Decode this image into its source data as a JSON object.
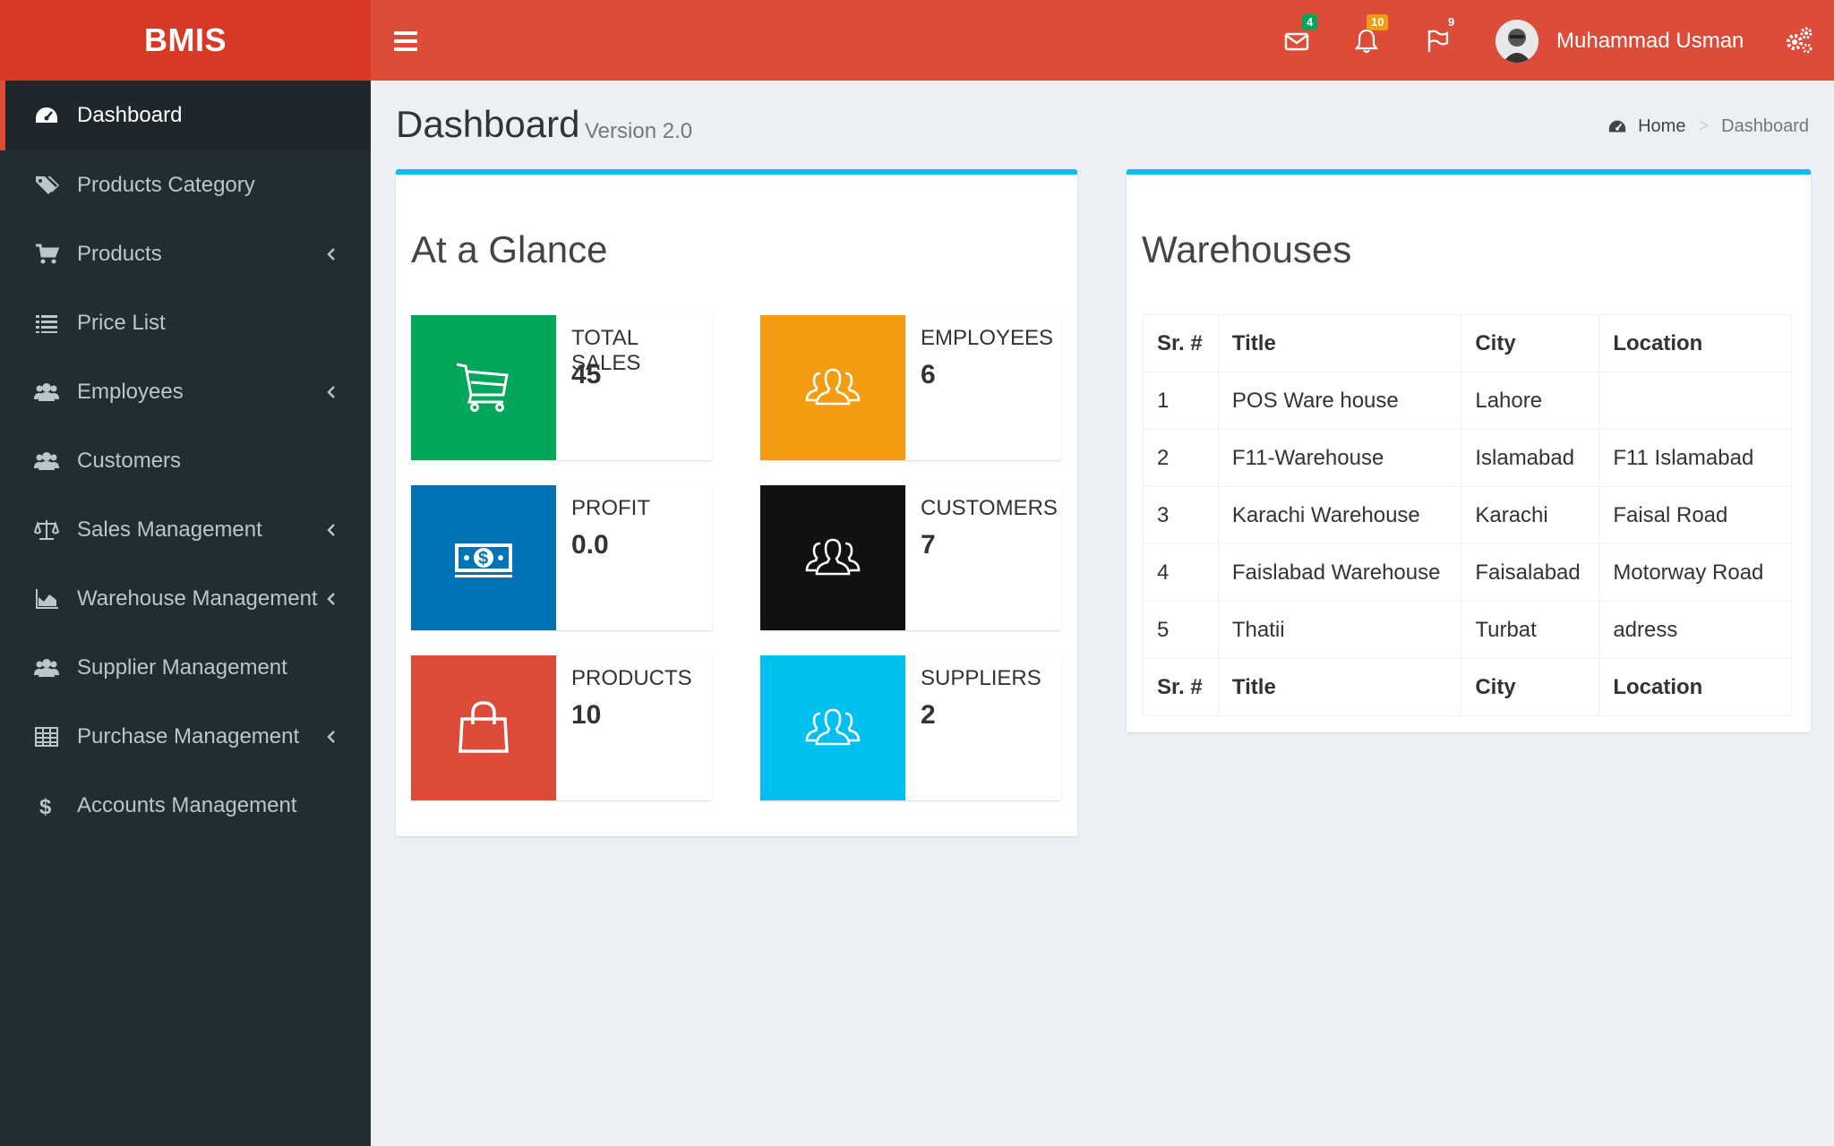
{
  "app": {
    "logo": "BMIS"
  },
  "colors": {
    "header": "#dd4b39",
    "logo_bg": "#d73925",
    "sidebar": "#222d32",
    "accent_border": "#00c0ef"
  },
  "sidebar": {
    "items": [
      {
        "label": "Dashboard",
        "icon": "dashboard-icon",
        "active": true,
        "submenu": false
      },
      {
        "label": "Products Category",
        "icon": "tags-icon",
        "active": false,
        "submenu": false
      },
      {
        "label": "Products",
        "icon": "cart-icon",
        "active": false,
        "submenu": true
      },
      {
        "label": "Price List",
        "icon": "list-icon",
        "active": false,
        "submenu": false
      },
      {
        "label": "Employees",
        "icon": "users-icon",
        "active": false,
        "submenu": true
      },
      {
        "label": "Customers",
        "icon": "users-icon",
        "active": false,
        "submenu": false
      },
      {
        "label": "Sales Management",
        "icon": "balance-scale-icon",
        "active": false,
        "submenu": true
      },
      {
        "label": "Warehouse Management",
        "icon": "area-chart-icon",
        "active": false,
        "submenu": true
      },
      {
        "label": "Supplier Management",
        "icon": "users-icon",
        "active": false,
        "submenu": false
      },
      {
        "label": "Purchase Management",
        "icon": "table-icon",
        "active": false,
        "submenu": true
      },
      {
        "label": "Accounts Management",
        "icon": "dollar-icon",
        "active": false,
        "submenu": false
      }
    ]
  },
  "header": {
    "messages_count": "4",
    "notifications_count": "10",
    "tasks_count": "9",
    "user_name": "Muhammad Usman"
  },
  "page": {
    "title": "Dashboard",
    "subtitle": "Version 2.0",
    "breadcrumb": [
      "Home",
      "Dashboard"
    ]
  },
  "glance": {
    "title": "At a Glance",
    "cards": [
      {
        "label": "TOTAL SALES",
        "value": "45",
        "color": "#00a65a",
        "icon": "shopping-cart-icon"
      },
      {
        "label": "EMPLOYEES",
        "value": "6",
        "color": "#f39c12",
        "icon": "people-icon"
      },
      {
        "label": "PROFIT",
        "value": "0.0",
        "color": "#0073b7",
        "icon": "money-icon"
      },
      {
        "label": "CUSTOMERS",
        "value": "7",
        "color": "#111111",
        "icon": "people-icon"
      },
      {
        "label": "PRODUCTS",
        "value": "10",
        "color": "#dd4b39",
        "icon": "shopping-bag-icon"
      },
      {
        "label": "SUPPLIERS",
        "value": "2",
        "color": "#00c0ef",
        "icon": "people-icon"
      }
    ]
  },
  "warehouses": {
    "title": "Warehouses",
    "columns": [
      "Sr. #",
      "Title",
      "City",
      "Location"
    ],
    "rows": [
      [
        "1",
        "POS Ware house",
        "Lahore",
        ""
      ],
      [
        "2",
        "F11-Warehouse",
        "Islamabad",
        "F11 Islamabad"
      ],
      [
        "3",
        "Karachi Warehouse",
        "Karachi",
        "Faisal Road"
      ],
      [
        "4",
        "Faislabad Warehouse",
        "Faisalabad",
        "Motorway Road"
      ],
      [
        "5",
        "Thatii",
        "Turbat",
        "adress"
      ]
    ]
  }
}
